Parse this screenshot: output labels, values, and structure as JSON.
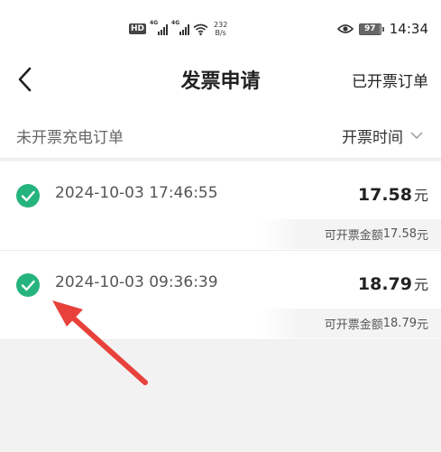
{
  "status_bar": {
    "hd_badge": "HD",
    "signal_1_label": "4G",
    "signal_2_label": "4G",
    "net_speed_value": "232",
    "net_speed_unit": "B/s",
    "battery_level": "97",
    "time": "14:34"
  },
  "nav": {
    "title": "发票申请",
    "right_action": "已开票订单"
  },
  "filter": {
    "label": "未开票充电订单",
    "sort_label": "开票时间"
  },
  "orders": [
    {
      "time": "2024-10-03 17:46:55",
      "amount": "17.58",
      "unit": "元",
      "invoiceable_label": "可开票金额",
      "invoiceable_amount": "17.58",
      "invoiceable_unit": "元",
      "selected": true
    },
    {
      "time": "2024-10-03 09:36:39",
      "amount": "18.79",
      "unit": "元",
      "invoiceable_label": "可开票金额",
      "invoiceable_amount": "18.79",
      "invoiceable_unit": "元",
      "selected": true
    }
  ],
  "colors": {
    "check_green": "#26b47e",
    "arrow_red": "#e8413c"
  },
  "annotation": {
    "icon": "red-arrow-pointer"
  }
}
